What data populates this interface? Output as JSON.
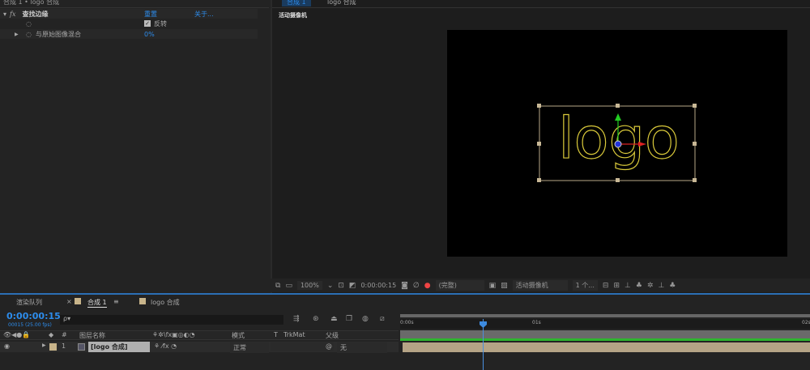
{
  "effect_panel": {
    "header": "合成 1 • logo 合成",
    "effect_name": "查找边缘",
    "reset": "重置",
    "about": "关于...",
    "invert_label": "反转",
    "invert_checked": true,
    "blend_label": "与原始图像混合",
    "blend_value": "0%"
  },
  "viewer": {
    "tabs": [
      "合成 1",
      "logo 合成"
    ],
    "camera_label": "活动摄像机",
    "logo_text": "logo",
    "toolbar": {
      "zoom": "100%",
      "timecode": "0:00:00:15",
      "resolution": "(完整)",
      "camera": "活动摄像机",
      "views": "1 个..."
    }
  },
  "timeline": {
    "tabs": [
      "渲染队列",
      "合成 1",
      "logo 合成"
    ],
    "timecode": "0:00:00:15",
    "fps": "00015 (25.00 fps)",
    "search_placeholder": "ρ▾",
    "columns": {
      "num": "#",
      "name": "图层名称",
      "mode": "模式",
      "t": "T",
      "trkmat": "TrkMat",
      "parent": "父级"
    },
    "layers": [
      {
        "num": "1",
        "name": "[logo 合成]",
        "mode": "正常",
        "parent": "无"
      }
    ],
    "ruler": [
      "0:00s",
      "01s",
      "02s"
    ],
    "colors": {
      "accent": "#2d8ceb",
      "layer_bar": "#b5a486",
      "work_area": "#2fb52f",
      "label": "#c8b48a"
    }
  }
}
